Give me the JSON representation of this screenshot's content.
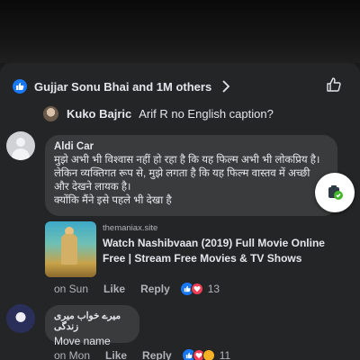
{
  "header": {
    "reactions_text": "Gujjar Sonu Bhai and 1M others"
  },
  "reply_preview": {
    "name": "Kuko Bajric",
    "text": "Arif R no English caption?"
  },
  "comment_1": {
    "name": "Aldi Car",
    "lines": [
      "मुझे अभी भी विश्वास नहीं हो रहा है कि यह फिल्म अभी भी लोकप्रिय है।",
      "   लेकिन व्यक्तिगत रूप से, मुझे लगता है कि यह फिल्म वास्तव में अच्छी",
      "और देखने लायक है।",
      "  क्योंकि मैंने इसे पहले भी देखा है"
    ],
    "link": {
      "site": "themaniax.site",
      "title_line1": "Watch Nashibvaan (2019) Full Movie Online",
      "title_line2": "Free | Stream Free Movies & TV Shows"
    },
    "time": "on Sun",
    "like_label": "Like",
    "reply_label": "Reply",
    "reaction_count": "13"
  },
  "comment_2": {
    "name": "میرے خواب میری زندگی",
    "text": "Move name",
    "time": "on Mon",
    "like_label": "Like",
    "reply_label": "Reply",
    "reaction_count": "11"
  },
  "colors": {
    "background": "#242526",
    "bubble": "#3a3b3c",
    "like_blue": "#1877f2",
    "love_red": "#f33e58"
  }
}
